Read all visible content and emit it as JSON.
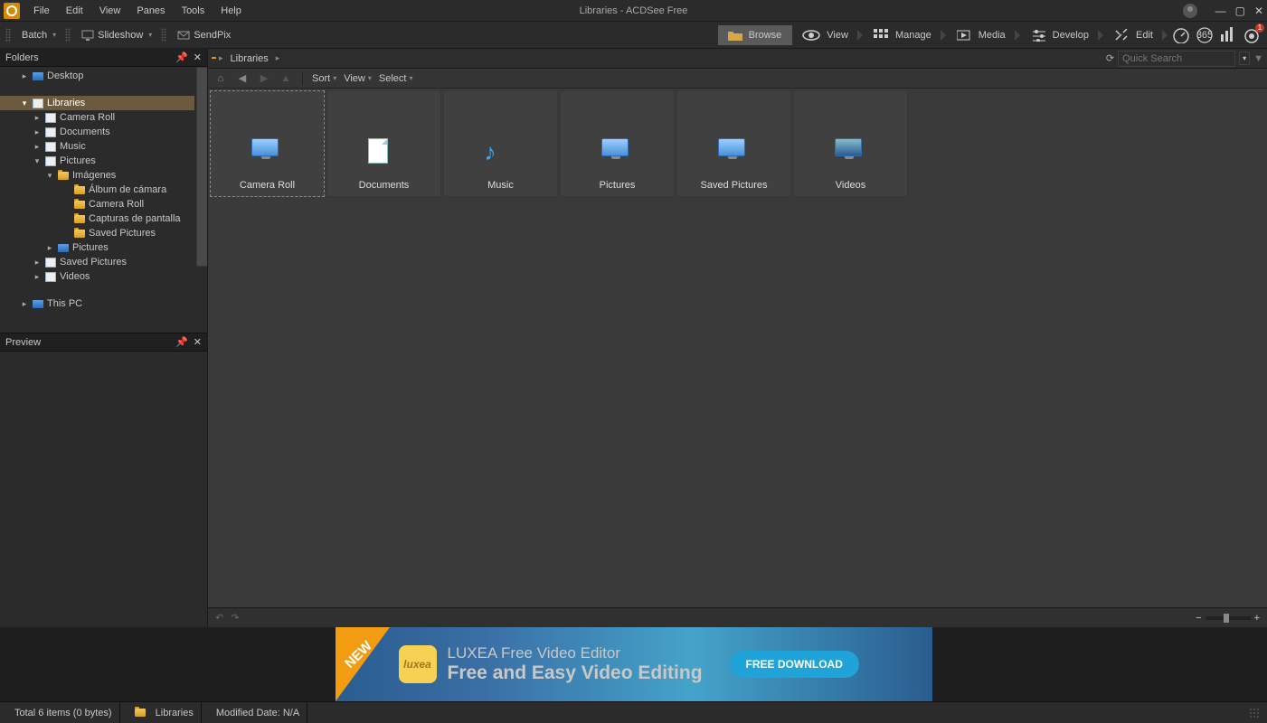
{
  "window": {
    "title": "Libraries - ACDSee Free"
  },
  "menu": {
    "items": [
      "File",
      "Edit",
      "View",
      "Panes",
      "Tools",
      "Help"
    ]
  },
  "toolbar": {
    "batch": "Batch",
    "slideshow": "Slideshow",
    "sendpix": "SendPix"
  },
  "modes": {
    "browse": "Browse",
    "view": "View",
    "manage": "Manage",
    "media": "Media",
    "develop": "Develop",
    "edit": "Edit"
  },
  "notification_count": "1",
  "panels": {
    "folders_title": "Folders",
    "preview_title": "Preview"
  },
  "tree": {
    "desktop": "Desktop",
    "libraries": "Libraries",
    "camera_roll": "Camera Roll",
    "documents": "Documents",
    "music": "Music",
    "pictures": "Pictures",
    "imagenes": "Imágenes",
    "album": "Álbum de cámara",
    "camera_roll2": "Camera Roll",
    "capturas": "Capturas de pantalla",
    "saved_pictures": "Saved Pictures",
    "pictures2": "Pictures",
    "saved_pictures2": "Saved Pictures",
    "videos": "Videos",
    "this_pc": "This PC"
  },
  "breadcrumb": {
    "root": "Libraries"
  },
  "search": {
    "placeholder": "Quick Search"
  },
  "nav": {
    "sort": "Sort",
    "view": "View",
    "select": "Select"
  },
  "items": [
    {
      "name": "Camera Roll",
      "type": "drive"
    },
    {
      "name": "Documents",
      "type": "doc"
    },
    {
      "name": "Music",
      "type": "music"
    },
    {
      "name": "Pictures",
      "type": "drive"
    },
    {
      "name": "Saved Pictures",
      "type": "drive"
    },
    {
      "name": "Videos",
      "type": "film"
    }
  ],
  "ad": {
    "badge": "NEW",
    "logo_text": "luxea",
    "line1": "LUXEA Free Video Editor",
    "line2": "Free and Easy Video Editing",
    "button": "FREE DOWNLOAD"
  },
  "status": {
    "total": "Total 6 items  (0 bytes)",
    "location": "Libraries",
    "modified": "Modified Date: N/A"
  }
}
